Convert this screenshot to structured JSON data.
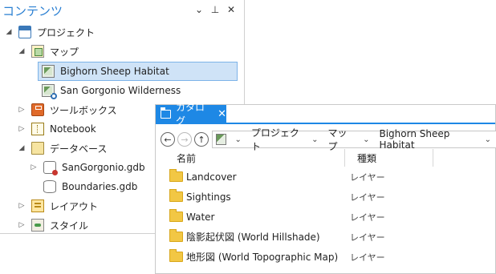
{
  "contents": {
    "title": "コンテンツ",
    "tools": {
      "menu": "⌄",
      "pin": "⊥",
      "close": "✕"
    },
    "tree": [
      {
        "label": "プロジェクト",
        "caret": "◢",
        "icon": "project-icon"
      },
      {
        "label": "マップ",
        "caret": "◢",
        "icon": "map-folder-icon"
      },
      {
        "label": "Bighorn Sheep Habitat",
        "caret": "",
        "icon": "map-icon"
      },
      {
        "label": "San Gorgonio Wilderness",
        "caret": "",
        "icon": "map-link-icon"
      },
      {
        "label": "ツールボックス",
        "caret": "▷",
        "icon": "toolbox-icon"
      },
      {
        "label": "Notebook",
        "caret": "▷",
        "icon": "notebook-icon"
      },
      {
        "label": "データベース",
        "caret": "◢",
        "icon": "database-folder-icon"
      },
      {
        "label": "SanGorgonio.gdb",
        "caret": "▷",
        "icon": "geodatabase-icon"
      },
      {
        "label": "Boundaries.gdb",
        "caret": "",
        "icon": "database-icon"
      },
      {
        "label": "レイアウト",
        "caret": "▷",
        "icon": "layout-icon"
      },
      {
        "label": "スタイル",
        "caret": "▷",
        "icon": "style-icon"
      }
    ]
  },
  "catalog": {
    "tab_label": "カタログ",
    "tab_close": "✕",
    "nav": {
      "back": "←",
      "forward": "→",
      "up": "↑"
    },
    "breadcrumbs": [
      "プロジェクト",
      "マップ",
      "Bighorn Sheep Habitat"
    ],
    "crumb_sep": "⌄",
    "columns": {
      "name": "名前",
      "type": "種類"
    },
    "items": [
      {
        "name": "Landcover",
        "type": "レイヤー"
      },
      {
        "name": "Sightings",
        "type": "レイヤー"
      },
      {
        "name": "Water",
        "type": "レイヤー"
      },
      {
        "name": "陰影起伏図 (World Hillshade)",
        "type": "レイヤー"
      },
      {
        "name": "地形図 (World Topographic Map)",
        "type": "レイヤー"
      }
    ]
  },
  "colors": {
    "accent": "#1e88e5",
    "title": "#2a7fd2",
    "selection": "#cfe3f7",
    "folder": "#f2c744"
  }
}
